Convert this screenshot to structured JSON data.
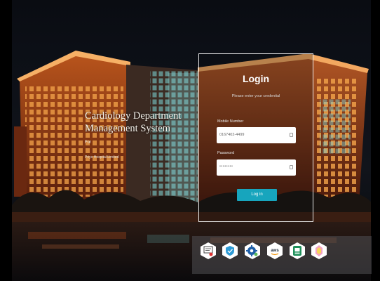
{
  "app": {
    "title_line1": "Cardiology Department",
    "title_line2": "Management System",
    "for_label": "For",
    "org_label": "Priyo Hospital Limited"
  },
  "login": {
    "title": "Login",
    "subtitle": "Please enter your credential",
    "mobile_label": "Mobile Number",
    "mobile_value": "0167402-4499",
    "password_label": "Password",
    "password_value": "••••••••",
    "button_label": "Log in"
  },
  "certifications": [
    {
      "icon": "award-certificate-icon"
    },
    {
      "icon": "verified-shield-icon"
    },
    {
      "icon": "security-gear-icon"
    },
    {
      "icon": "aws-icon",
      "text": "aws"
    },
    {
      "icon": "compliance-badge-icon"
    },
    {
      "icon": "quality-badge-icon"
    }
  ],
  "colors": {
    "button": "#17a5bd",
    "box_border": "#e9e9e9",
    "building_glow": "#e8822e"
  }
}
